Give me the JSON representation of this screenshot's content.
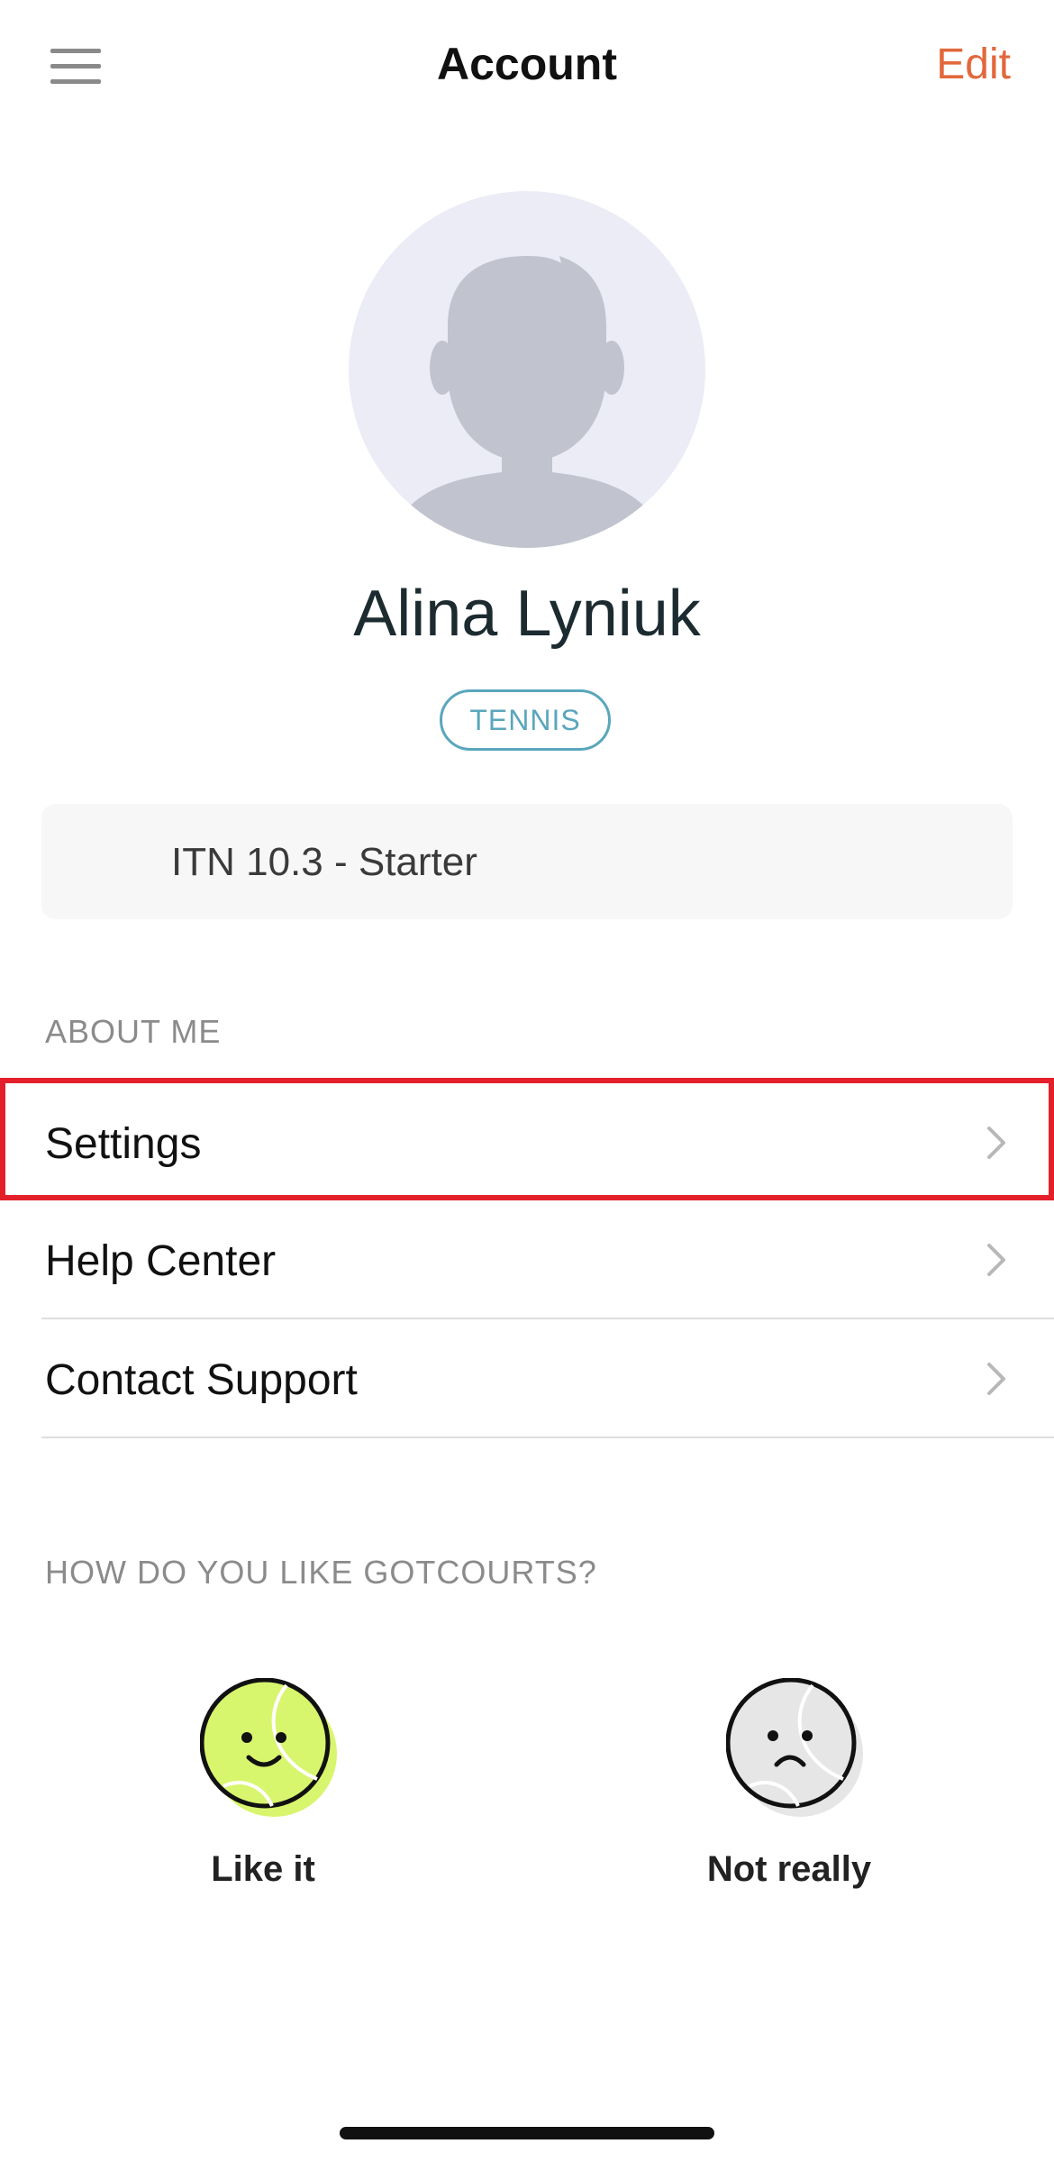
{
  "header": {
    "title": "Account",
    "edit_label": "Edit",
    "menu_icon": "hamburger-icon"
  },
  "profile": {
    "name": "Alina Lyniuk",
    "sport_tag": "TENNIS",
    "rating": "ITN 10.3 - Starter"
  },
  "about": {
    "section_label": "ABOUT ME",
    "items": [
      {
        "label": "Settings",
        "icon": "chevron-right-icon"
      },
      {
        "label": "Help Center",
        "icon": "chevron-right-icon"
      },
      {
        "label": "Contact Support",
        "icon": "chevron-right-icon"
      }
    ]
  },
  "feedback": {
    "section_label": "HOW DO YOU LIKE GOTCOURTS?",
    "like_label": "Like it",
    "dislike_label": "Not really"
  },
  "colors": {
    "accent": "#e2683c",
    "tag": "#5aa6bd",
    "highlight": "#e3202a",
    "like_ball": "#d8f56e",
    "dislike_ball": "#e6e6e6"
  }
}
